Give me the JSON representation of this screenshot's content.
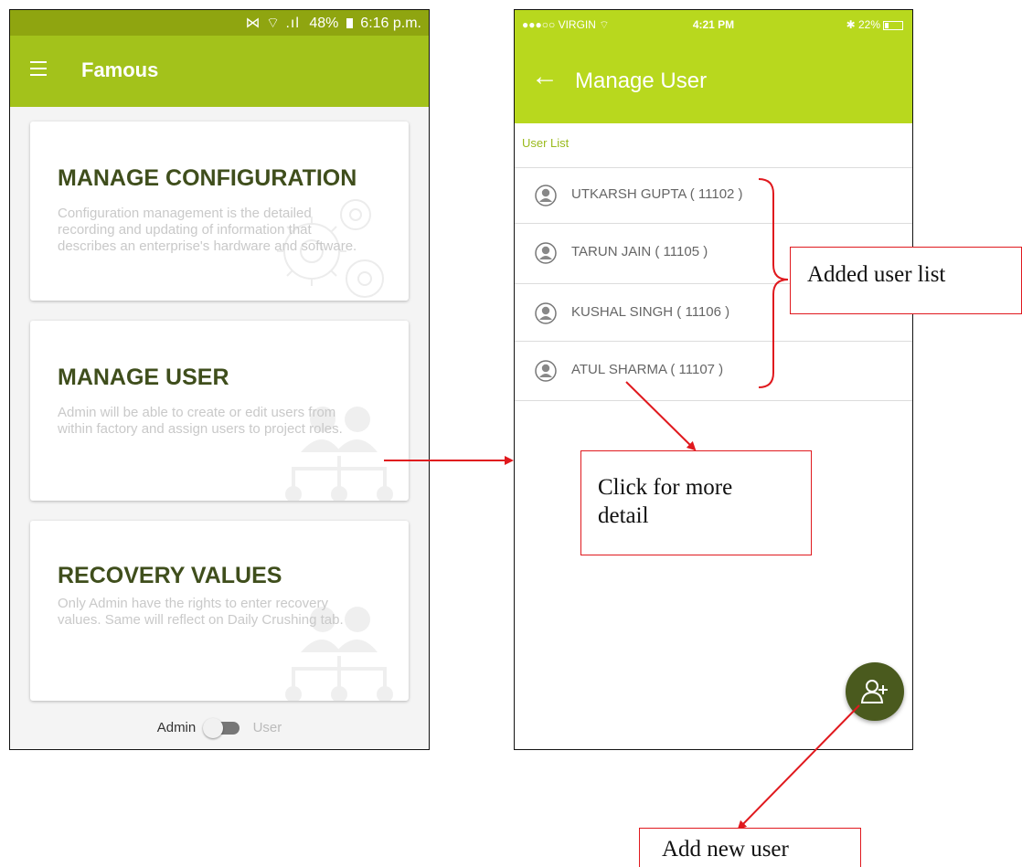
{
  "left_screen": {
    "status_bar": {
      "icons": "⋈ ⌔ .ıl",
      "battery": "48%",
      "time": "6:16 p.m."
    },
    "app_bar": {
      "title": "Famous"
    },
    "cards": [
      {
        "title": "MANAGE CONFIGURATION",
        "description": "Configuration management is the detailed recording and updating of information that describes an enterprise's hardware and software.",
        "watermark_icon": "gears-icon"
      },
      {
        "title": "MANAGE USER",
        "description": "Admin will be able to create or edit users from within factory and assign users to project roles.",
        "watermark_icon": "org-chart-icon"
      },
      {
        "title": "RECOVERY VALUES",
        "description": "Only Admin have the rights to enter recovery values. Same will reflect on Daily Crushing tab.",
        "watermark_icon": "org-chart-icon"
      }
    ],
    "toggle": {
      "left_label": "Admin",
      "right_label": "User"
    }
  },
  "right_screen": {
    "status_bar": {
      "carrier": "●●●○○ VIRGIN ⌔",
      "time": "4:21 PM",
      "battery": "✱ 22%"
    },
    "app_bar": {
      "back_icon": "←",
      "title": "Manage User"
    },
    "section_label": "User List",
    "users": [
      {
        "name": "UTKARSH  GUPTA ( 11102 )"
      },
      {
        "name": "TARUN JAIN ( 11105 )"
      },
      {
        "name": "KUSHAL SINGH ( 11106 )"
      },
      {
        "name": "ATUL SHARMA ( 11107 )"
      }
    ],
    "fab": {
      "icon": "add-user-icon"
    }
  },
  "annotations": {
    "added_user_list": "Added user list",
    "click_more_line1": "Click for more",
    "click_more_line2": "detail",
    "add_new_user": "Add new user"
  },
  "colors": {
    "android_status": "#8fa510",
    "android_appbar": "#a3c21b",
    "ios_appbar": "#b8d81e",
    "card_title": "#3f4e1c",
    "fab": "#4a5a1e",
    "annotation_red": "#e0191e"
  }
}
